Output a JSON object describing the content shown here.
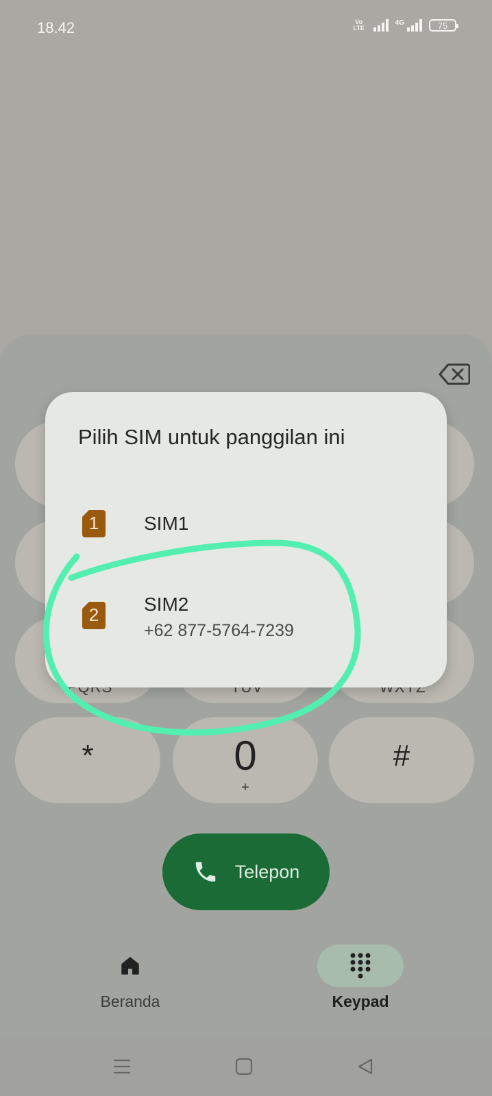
{
  "status_bar": {
    "time": "18.42",
    "volte_top": "Vo",
    "volte_bottom": "LTE",
    "network": "4G",
    "battery": "75"
  },
  "keypad": {
    "keys": [
      {
        "digit": "*",
        "letters": ""
      },
      {
        "digit": "0",
        "letters": "+"
      },
      {
        "digit": "#",
        "letters": ""
      }
    ],
    "partial_letters": [
      "PQRS",
      "TUV",
      "WXYZ"
    ]
  },
  "call_button": {
    "label": "Telepon",
    "color": "#1a6b36"
  },
  "bottom_nav": [
    {
      "label": "Beranda",
      "icon": "home-icon",
      "active": false
    },
    {
      "label": "Keypad",
      "icon": "dialpad-icon",
      "active": true
    }
  ],
  "system_nav": [
    "menu-icon",
    "home-square-icon",
    "back-triangle-icon"
  ],
  "dialog": {
    "title": "Pilih SIM untuk panggilan ini",
    "options": [
      {
        "badge": "1",
        "name": "SIM1",
        "number": ""
      },
      {
        "badge": "2",
        "name": "SIM2",
        "number": "+62 877-5764-7239"
      }
    ],
    "sim_icon_color": "#9a5a0e"
  },
  "annotation": {
    "color": "#52efb0"
  }
}
